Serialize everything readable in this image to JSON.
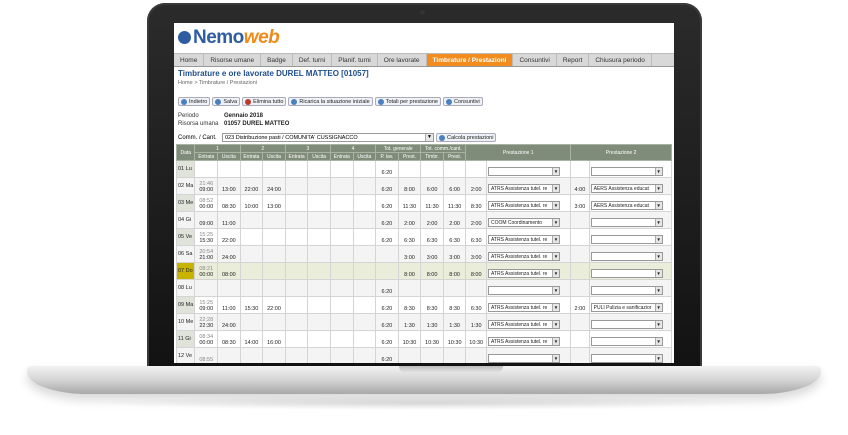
{
  "app": {
    "logo_part1": "Nemo",
    "logo_part2": "web"
  },
  "nav": [
    "Home",
    "Risorse umane",
    "Badge",
    "Def. turni",
    "Planif. turni",
    "Ore lavorate",
    "Timbrature / Prestazioni",
    "Consuntivi",
    "Report",
    "Chiusura periodo"
  ],
  "page": {
    "title": "Timbrature e ore lavorate DUREL MATTEO [01057]",
    "breadcrumb": "Home > Timbrature / Prestazioni"
  },
  "toolbar": [
    "Indietro",
    "Salva",
    "Elimina tutto",
    "Ricarica la situazione iniziale",
    "Totali per prestazione",
    "Consuntivi"
  ],
  "info": {
    "periodo_label": "Periodo",
    "periodo_value": "Gennaio 2018",
    "risorsa_label": "Risorsa umana",
    "risorsa_value": "01057 DUREL MATTEO",
    "comm_label": "Comm. / Cant.",
    "comm_value": "023 Distribuzione pasti / COMUNITA' CUSSIGNACCO",
    "calc_button": "Calcola prestazioni"
  },
  "table": {
    "group_headers": [
      "Data",
      "1",
      "2",
      "3",
      "4",
      "Tot. generale",
      "Tot. comm./cant.",
      "Prestazione 1",
      "Prestazione 2"
    ],
    "sub_headers": [
      "Entrata",
      "Uscita",
      "Entrata",
      "Uscita",
      "Entrata",
      "Uscita",
      "Entrata",
      "Uscita",
      "P. lav.",
      "Prest.",
      "Timbr.",
      "Prest."
    ],
    "rows": [
      {
        "day": "01 Lu",
        "e1a": "",
        "e1": "",
        "u1": "",
        "e2": "",
        "u2": "",
        "plav": "6:20",
        "prest": "",
        "timbr": "",
        "prest2": "",
        "p1h": "",
        "p1": "",
        "p2h": "",
        "p2": ""
      },
      {
        "day": "02 Ma",
        "e1a": "21:46",
        "e1": "09:00",
        "u1": "13:00",
        "e2": "22:00",
        "u2": "24:00",
        "plav": "6:20",
        "prest": "8:00",
        "timbr": "6:00",
        "prest2": "6:00",
        "p1h": "2:00",
        "p1": "ATRS Assistenza tutel. re",
        "p2h": "4:00",
        "p2": "AERS Assistenza educat"
      },
      {
        "day": "03 Me",
        "e1a": "08:52",
        "e1": "00:00",
        "u1": "08:30",
        "e2": "10:00",
        "u2": "13:00",
        "plav": "6:20",
        "prest": "11:30",
        "timbr": "11:30",
        "prest2": "11:30",
        "p1h": "8:30",
        "p1": "ATRS Assistenza tutel. re",
        "p2h": "3:00",
        "p2": "AERS Assistenza educat"
      },
      {
        "day": "04 Gi",
        "e1a": "",
        "e1": "09:00",
        "u1": "11:00",
        "e2": "",
        "u2": "",
        "plav": "6:20",
        "prest": "2:00",
        "timbr": "2:00",
        "prest2": "2:00",
        "p1h": "2:00",
        "p1": "COOM Coordinamento",
        "p2h": "",
        "p2": ""
      },
      {
        "day": "05 Ve",
        "e1a": "15:25",
        "e1": "15:30",
        "u1": "22:00",
        "e2": "",
        "u2": "",
        "plav": "6:20",
        "prest": "6:30",
        "timbr": "6:30",
        "prest2": "6:30",
        "p1h": "6:30",
        "p1": "ATRS Assistenza tutel. re",
        "p2h": "",
        "p2": ""
      },
      {
        "day": "06 Sa",
        "e1a": "20:54",
        "e1": "21:00",
        "u1": "24:00",
        "e2": "",
        "u2": "",
        "plav": "",
        "prest": "3:00",
        "timbr": "3:00",
        "prest2": "3:00",
        "p1h": "3:00",
        "p1": "ATRS Assistenza tutel. re",
        "p2h": "",
        "p2": ""
      },
      {
        "day": "07 Do",
        "e1a": "08:21",
        "e1": "00:00",
        "u1": "08:00",
        "e2": "",
        "u2": "",
        "plav": "",
        "prest": "8:00",
        "timbr": "8:00",
        "prest2": "8:00",
        "p1h": "8:00",
        "p1": "ATRS Assistenza tutel. re",
        "p2h": "",
        "p2": ""
      },
      {
        "day": "08 Lu",
        "e1a": "",
        "e1": "",
        "u1": "",
        "e2": "",
        "u2": "",
        "plav": "6:20",
        "prest": "",
        "timbr": "",
        "prest2": "",
        "p1h": "",
        "p1": "",
        "p2h": "",
        "p2": ""
      },
      {
        "day": "09 Ma",
        "e1a": "15:25",
        "e1": "09:00",
        "u1": "11:00",
        "e2": "15:30",
        "u2": "22:00",
        "plav": "6:20",
        "prest": "8:30",
        "timbr": "8:30",
        "prest2": "8:30",
        "p1h": "6:30",
        "p1": "ATRS Assistenza tutel. re",
        "p2h": "2:00",
        "p2": "PULI Pulizia e sanificazior"
      },
      {
        "day": "10 Me",
        "e1a": "22:28",
        "e1": "22:30",
        "u1": "24:00",
        "e2": "",
        "u2": "",
        "plav": "6:20",
        "prest": "1:30",
        "timbr": "1:30",
        "prest2": "1:30",
        "p1h": "1:30",
        "p1": "ATRS Assistenza tutel. re",
        "p2h": "",
        "p2": ""
      },
      {
        "day": "11 Gi",
        "e1a": "08:34",
        "e1": "00:00",
        "u1": "08:30",
        "e2": "14:00",
        "u2": "16:00",
        "plav": "6:20",
        "prest": "10:30",
        "timbr": "10:30",
        "prest2": "10:30",
        "p1h": "10:30",
        "p1": "ATRS Assistenza tutel. re",
        "p2h": "",
        "p2": ""
      },
      {
        "day": "12 Ve",
        "e1a": "08:55",
        "e1": "",
        "u1": "",
        "e2": "",
        "u2": "",
        "plav": "6:20",
        "prest": "",
        "timbr": "",
        "prest2": "",
        "p1h": "",
        "p1": "",
        "p2h": "",
        "p2": ""
      }
    ]
  }
}
